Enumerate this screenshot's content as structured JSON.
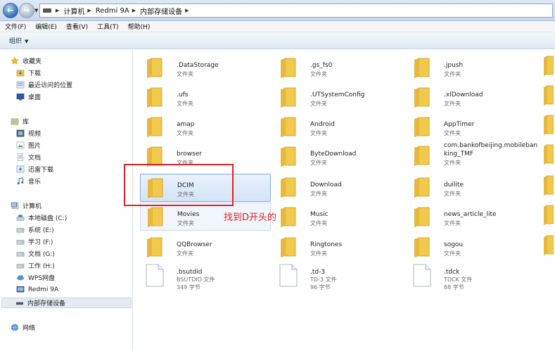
{
  "address": {
    "crumbs": [
      "计算机",
      "Redmi 9A",
      "内部存储设备"
    ]
  },
  "menu": [
    "文件(F)",
    "编辑(E)",
    "查看(V)",
    "工具(T)",
    "帮助(H)"
  ],
  "toolbar": {
    "organize": "组织"
  },
  "nav": {
    "favorites": "收藏夹",
    "downloads": "下载",
    "recent": "最近访问的位置",
    "desktop": "桌面",
    "libraries": "库",
    "videos": "视频",
    "pictures": "图片",
    "documents": "文档",
    "thunder": "迅雷下载",
    "music": "音乐",
    "computer": "计算机",
    "disk_c": "本地磁盘 (C:)",
    "disk_e": "系统 (E:)",
    "disk_f": "学习 (F:)",
    "disk_g": "文档 (G:)",
    "disk_h": "工作 (H:)",
    "wps": "WPS网盘",
    "redmi": "Redmi 9A",
    "internal": "内部存储设备",
    "network": "网络"
  },
  "folder_type": "文件夹",
  "items": [
    {
      "name": ".DataStorage",
      "type": "文件夹"
    },
    {
      "name": ".gs_fs0",
      "type": "文件夹"
    },
    {
      "name": ".jpush",
      "type": "文件夹"
    },
    {
      "name": ".ufs",
      "type": "文件夹"
    },
    {
      "name": ".UTSystemConfig",
      "type": "文件夹"
    },
    {
      "name": ".xlDownload",
      "type": "文件夹"
    },
    {
      "name": "amap",
      "type": "文件夹"
    },
    {
      "name": "Android",
      "type": "文件夹"
    },
    {
      "name": "AppTimer",
      "type": "文件夹"
    },
    {
      "name": "browser",
      "type": "文件夹"
    },
    {
      "name": "ByteDownload",
      "type": "文件夹"
    },
    {
      "name": "com.bankofbeijing.mobilebanking_TMF",
      "type": "文件夹"
    },
    {
      "name": "DCIM",
      "type": "文件夹"
    },
    {
      "name": "Download",
      "type": "文件夹"
    },
    {
      "name": "duilite",
      "type": "文件夹"
    },
    {
      "name": "Movies",
      "type": "文件夹"
    },
    {
      "name": "Music",
      "type": "文件夹"
    },
    {
      "name": "news_article_lite",
      "type": "文件夹"
    },
    {
      "name": "QQBrowser",
      "type": "文件夹"
    },
    {
      "name": "Ringtones",
      "type": "文件夹"
    },
    {
      "name": "sogou",
      "type": "文件夹"
    },
    {
      "name": ".bsutdid",
      "type": "BSUTDID 文件",
      "size": "349 字节"
    },
    {
      "name": ".td-3",
      "type": "TD-3 文件",
      "size": "96 字节"
    },
    {
      "name": ".tdck",
      "type": "TDCK 文件",
      "size": "88 字节"
    }
  ],
  "annotation": "找到D开头的",
  "colors": {
    "folder": "#f1c94d",
    "annotation": "#e02020",
    "selection": "#d3e3f7"
  }
}
